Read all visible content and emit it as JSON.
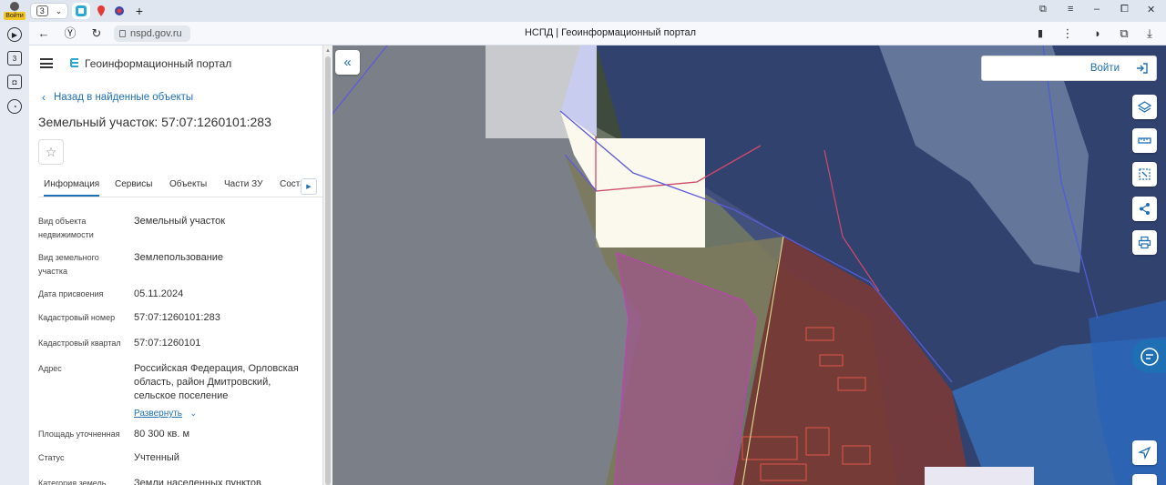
{
  "browser": {
    "profile_label": "Войти",
    "tab_count": "3",
    "url": "nspd.gov.ru",
    "page_title": "НСПД | Геоинформационный портал",
    "sidebar_badge": "3"
  },
  "panel": {
    "app_title": "Геоинформационный портал",
    "back_link": "Назад в найденные объекты",
    "object_title": "Земельный участок: 57:07:1260101:283",
    "tabs": [
      "Информация",
      "Сервисы",
      "Объекты",
      "Части ЗУ",
      "Соста"
    ],
    "fields": [
      {
        "label": "Вид объекта недвижимости",
        "value": "Земельный участок"
      },
      {
        "label": "Вид земельного участка",
        "value": "Землепользование"
      },
      {
        "label": "Дата присвоения",
        "value": "05.11.2024"
      },
      {
        "label": "Кадастровый номер",
        "value": "57:07:1260101:283"
      },
      {
        "label": "Кадастровый квартал",
        "value": "57:07:1260101"
      },
      {
        "label": "Адрес",
        "value": "Российская Федерация, Орловская область, район Дмитровский, сельское поселение"
      },
      {
        "label": "Площадь уточненная",
        "value": "80 300 кв. м"
      },
      {
        "label": "Статус",
        "value": "Учтенный"
      },
      {
        "label": "Категория земель",
        "value": "Земли населенных пунктов"
      }
    ],
    "expand_label": "Развернуть"
  },
  "map": {
    "login_label": "Войти",
    "accent": "#1f6fb4"
  }
}
